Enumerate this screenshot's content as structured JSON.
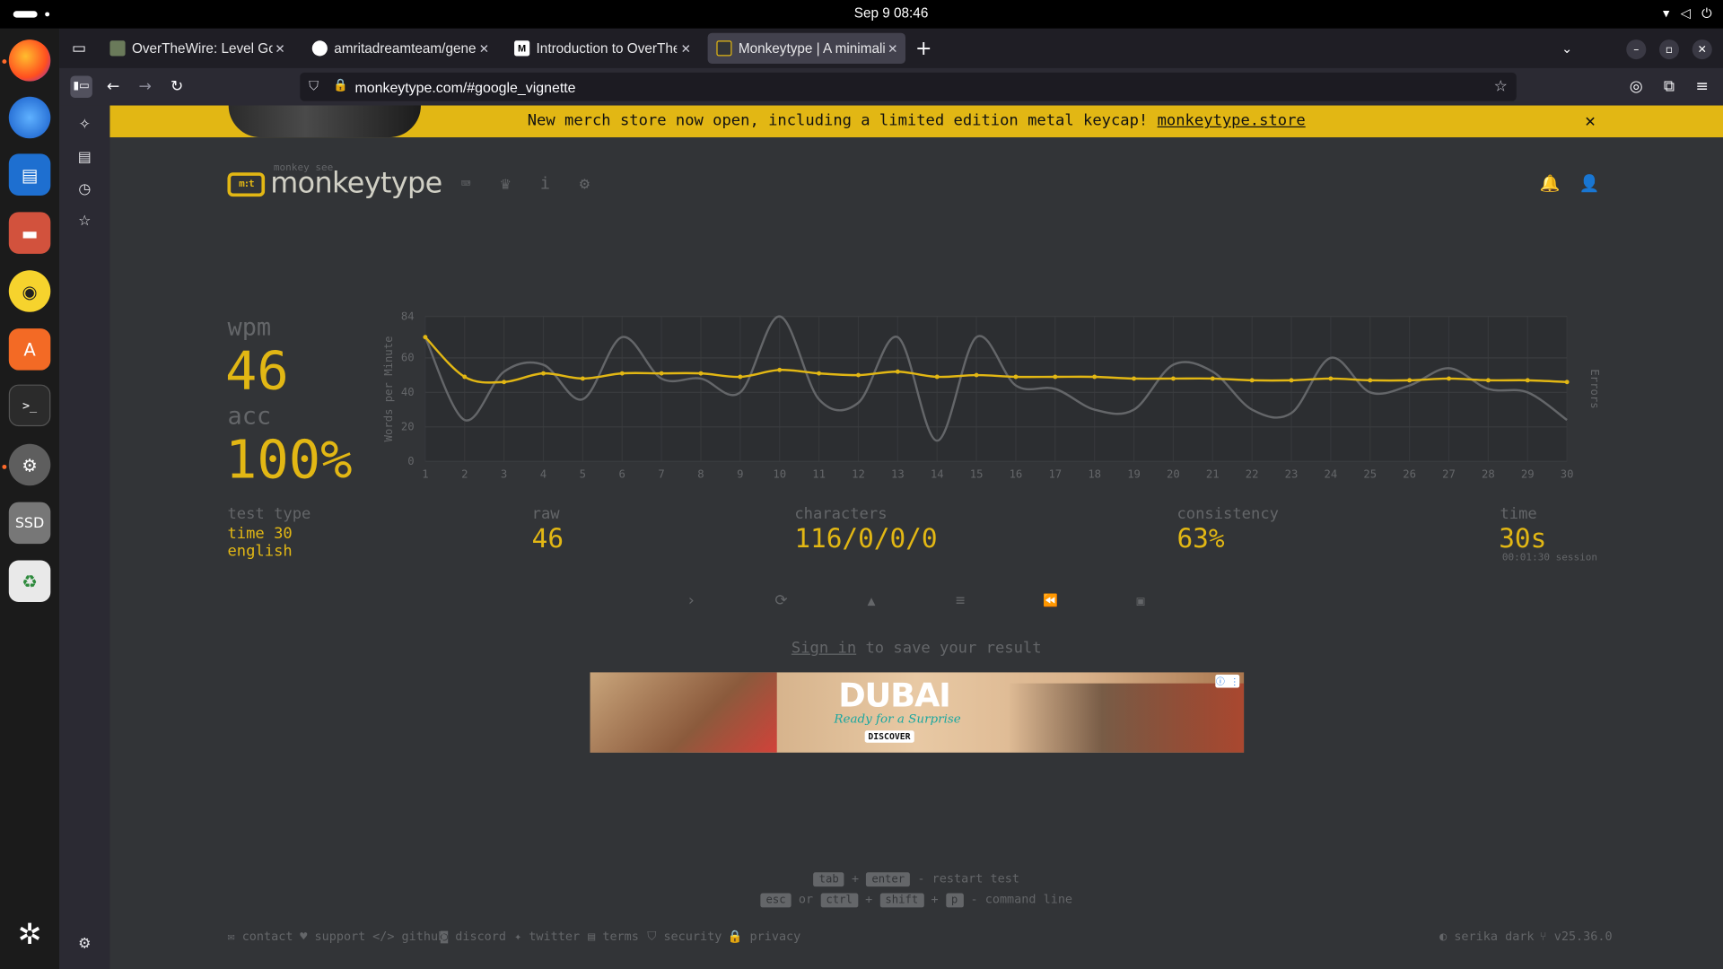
{
  "system": {
    "clock": "Sep 9  08:46"
  },
  "browser": {
    "tabs": [
      {
        "title": "OverTheWire: Level Goal",
        "favicon": "flag"
      },
      {
        "title": "amritadreamteam/genesi",
        "favicon": "github"
      },
      {
        "title": "Introduction to OverThe",
        "favicon": "medium"
      },
      {
        "title": "Monkeytype | A minimalis",
        "favicon": "monkeytype"
      }
    ],
    "url": "monkeytype.com/#google_vignette"
  },
  "banner": {
    "text": "New merch store now open, including a limited edition metal keycap!",
    "link": "monkeytype.store",
    "close": "✕"
  },
  "header": {
    "logo_top": "monkey see",
    "logo": "monkeytype",
    "logo_icon_text": "m:t"
  },
  "results": {
    "wpm_label": "wpm",
    "wpm": "46",
    "acc_label": "acc",
    "acc": "100%",
    "test_type_label": "test type",
    "test_type_mode": "time 30",
    "test_type_lang": "english",
    "raw_label": "raw",
    "raw": "46",
    "characters_label": "characters",
    "characters": "116/0/0/0",
    "consistency_label": "consistency",
    "consistency": "63%",
    "time_label": "time",
    "time": "30s",
    "session": "00:01:30 session"
  },
  "chart_data": {
    "type": "line",
    "xlabel": "",
    "ylabel": "Words per Minute",
    "y2label": "Errors",
    "x": [
      1,
      2,
      3,
      4,
      5,
      6,
      7,
      8,
      9,
      10,
      11,
      12,
      13,
      14,
      15,
      16,
      17,
      18,
      19,
      20,
      21,
      22,
      23,
      24,
      25,
      26,
      27,
      28,
      29,
      30
    ],
    "ylim": [
      0,
      84
    ],
    "yticks": [
      0,
      20,
      40,
      60,
      84
    ],
    "grid": true,
    "series": [
      {
        "name": "wpm",
        "color": "#e2b714",
        "values": [
          72,
          49,
          46,
          51,
          48,
          51,
          51,
          51,
          49,
          53,
          51,
          50,
          52,
          49,
          50,
          49,
          49,
          49,
          48,
          48,
          48,
          47,
          47,
          48,
          47,
          47,
          48,
          47,
          47,
          46
        ]
      },
      {
        "name": "raw",
        "color": "#646669",
        "values": [
          72,
          24,
          52,
          56,
          36,
          72,
          48,
          48,
          40,
          84,
          36,
          34,
          72,
          12,
          72,
          44,
          42,
          30,
          30,
          56,
          52,
          30,
          28,
          60,
          40,
          44,
          54,
          42,
          40,
          24
        ]
      }
    ]
  },
  "actions": [
    {
      "name": "next-test-icon",
      "glyph": "›"
    },
    {
      "name": "restart-icon",
      "glyph": "⟳"
    },
    {
      "name": "warning-icon",
      "glyph": "▲"
    },
    {
      "name": "words-history-icon",
      "glyph": "≡"
    },
    {
      "name": "replay-icon",
      "glyph": "⏪"
    },
    {
      "name": "screenshot-icon",
      "glyph": "▣"
    }
  ],
  "signin": {
    "link": "Sign in",
    "text": " to save your result"
  },
  "ad": {
    "brand": "DUBAI",
    "tagline": "Ready for a Surprise",
    "cta": "DISCOVER"
  },
  "shortcuts": {
    "line1": {
      "k1": "tab",
      "plus": "+",
      "k2": "enter",
      "desc": " - restart test"
    },
    "line2": {
      "k1": "esc",
      "or": "or",
      "k2": "ctrl",
      "k3": "shift",
      "k4": "p",
      "desc": " - command line"
    }
  },
  "footer": {
    "links": [
      "contact",
      "support",
      "github",
      "discord",
      "twitter",
      "terms",
      "security",
      "privacy"
    ],
    "theme": "serika dark",
    "version": "v25.36.0"
  },
  "colors": {
    "accent": "#e2b714",
    "bg": "#323437",
    "sub": "#646669",
    "text": "#d1d0c5"
  }
}
